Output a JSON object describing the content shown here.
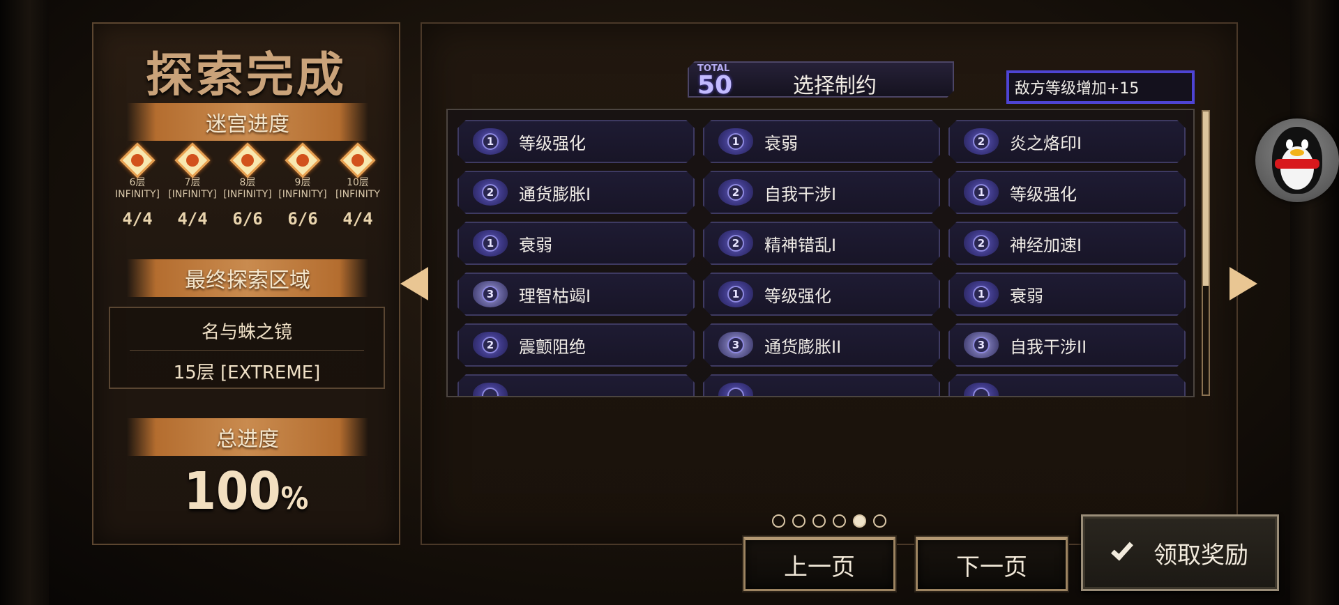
{
  "left": {
    "title": "探索完成",
    "progress_banner": "迷宫进度",
    "floors": [
      {
        "name": "6层",
        "mode": "INFINITY]",
        "score": "4/4"
      },
      {
        "name": "7层",
        "mode": "[INFINITY]",
        "score": "4/4"
      },
      {
        "name": "8层",
        "mode": "[INFINITY]",
        "score": "6/6"
      },
      {
        "name": "9层",
        "mode": "[INFINITY]",
        "score": "6/6"
      },
      {
        "name": "10层",
        "mode": "[INFINITY",
        "score": "4/4"
      }
    ],
    "final_area_banner": "最终探索区域",
    "final_area_name": "名与蛛之镜",
    "final_area_floor": "15层 [EXTREME]",
    "total_banner": "总进度",
    "total_value": "100",
    "total_unit": "%"
  },
  "right": {
    "total_label": "TOTAL",
    "total_value": "50",
    "select_title": "选择制约",
    "enemy_level_text": "敌方等级增加+15",
    "rows": [
      [
        {
          "tier": "1",
          "label": "等级强化"
        },
        {
          "tier": "1",
          "label": "衰弱"
        },
        {
          "tier": "2",
          "label": "炎之烙印I"
        }
      ],
      [
        {
          "tier": "2",
          "label": "通货膨胀I"
        },
        {
          "tier": "2",
          "label": "自我干涉I"
        },
        {
          "tier": "1",
          "label": "等级强化"
        }
      ],
      [
        {
          "tier": "1",
          "label": "衰弱"
        },
        {
          "tier": "2",
          "label": "精神错乱I"
        },
        {
          "tier": "2",
          "label": "神经加速I"
        }
      ],
      [
        {
          "tier": "3",
          "label": "理智枯竭I"
        },
        {
          "tier": "1",
          "label": "等级强化"
        },
        {
          "tier": "1",
          "label": "衰弱"
        }
      ],
      [
        {
          "tier": "2",
          "label": "震颤阻绝"
        },
        {
          "tier": "3",
          "label": "通货膨胀II"
        },
        {
          "tier": "3",
          "label": "自我干涉II"
        }
      ],
      [
        {
          "tier": "",
          "label": ""
        },
        {
          "tier": "",
          "label": ""
        },
        {
          "tier": "",
          "label": ""
        }
      ]
    ],
    "page_count": 6,
    "active_page": 5,
    "prev_label": "上一页",
    "next_label": "下一页",
    "claim_label": "领取奖励"
  },
  "colors": {
    "accent_purple": "#4e44d4",
    "banner_orange": "#c98b4f",
    "title_gold": "#caa37a"
  },
  "icons": {
    "left_arrow": "triangle-left",
    "right_arrow": "triangle-right",
    "claim": "check-icon",
    "overlay": "penguin-avatar"
  }
}
